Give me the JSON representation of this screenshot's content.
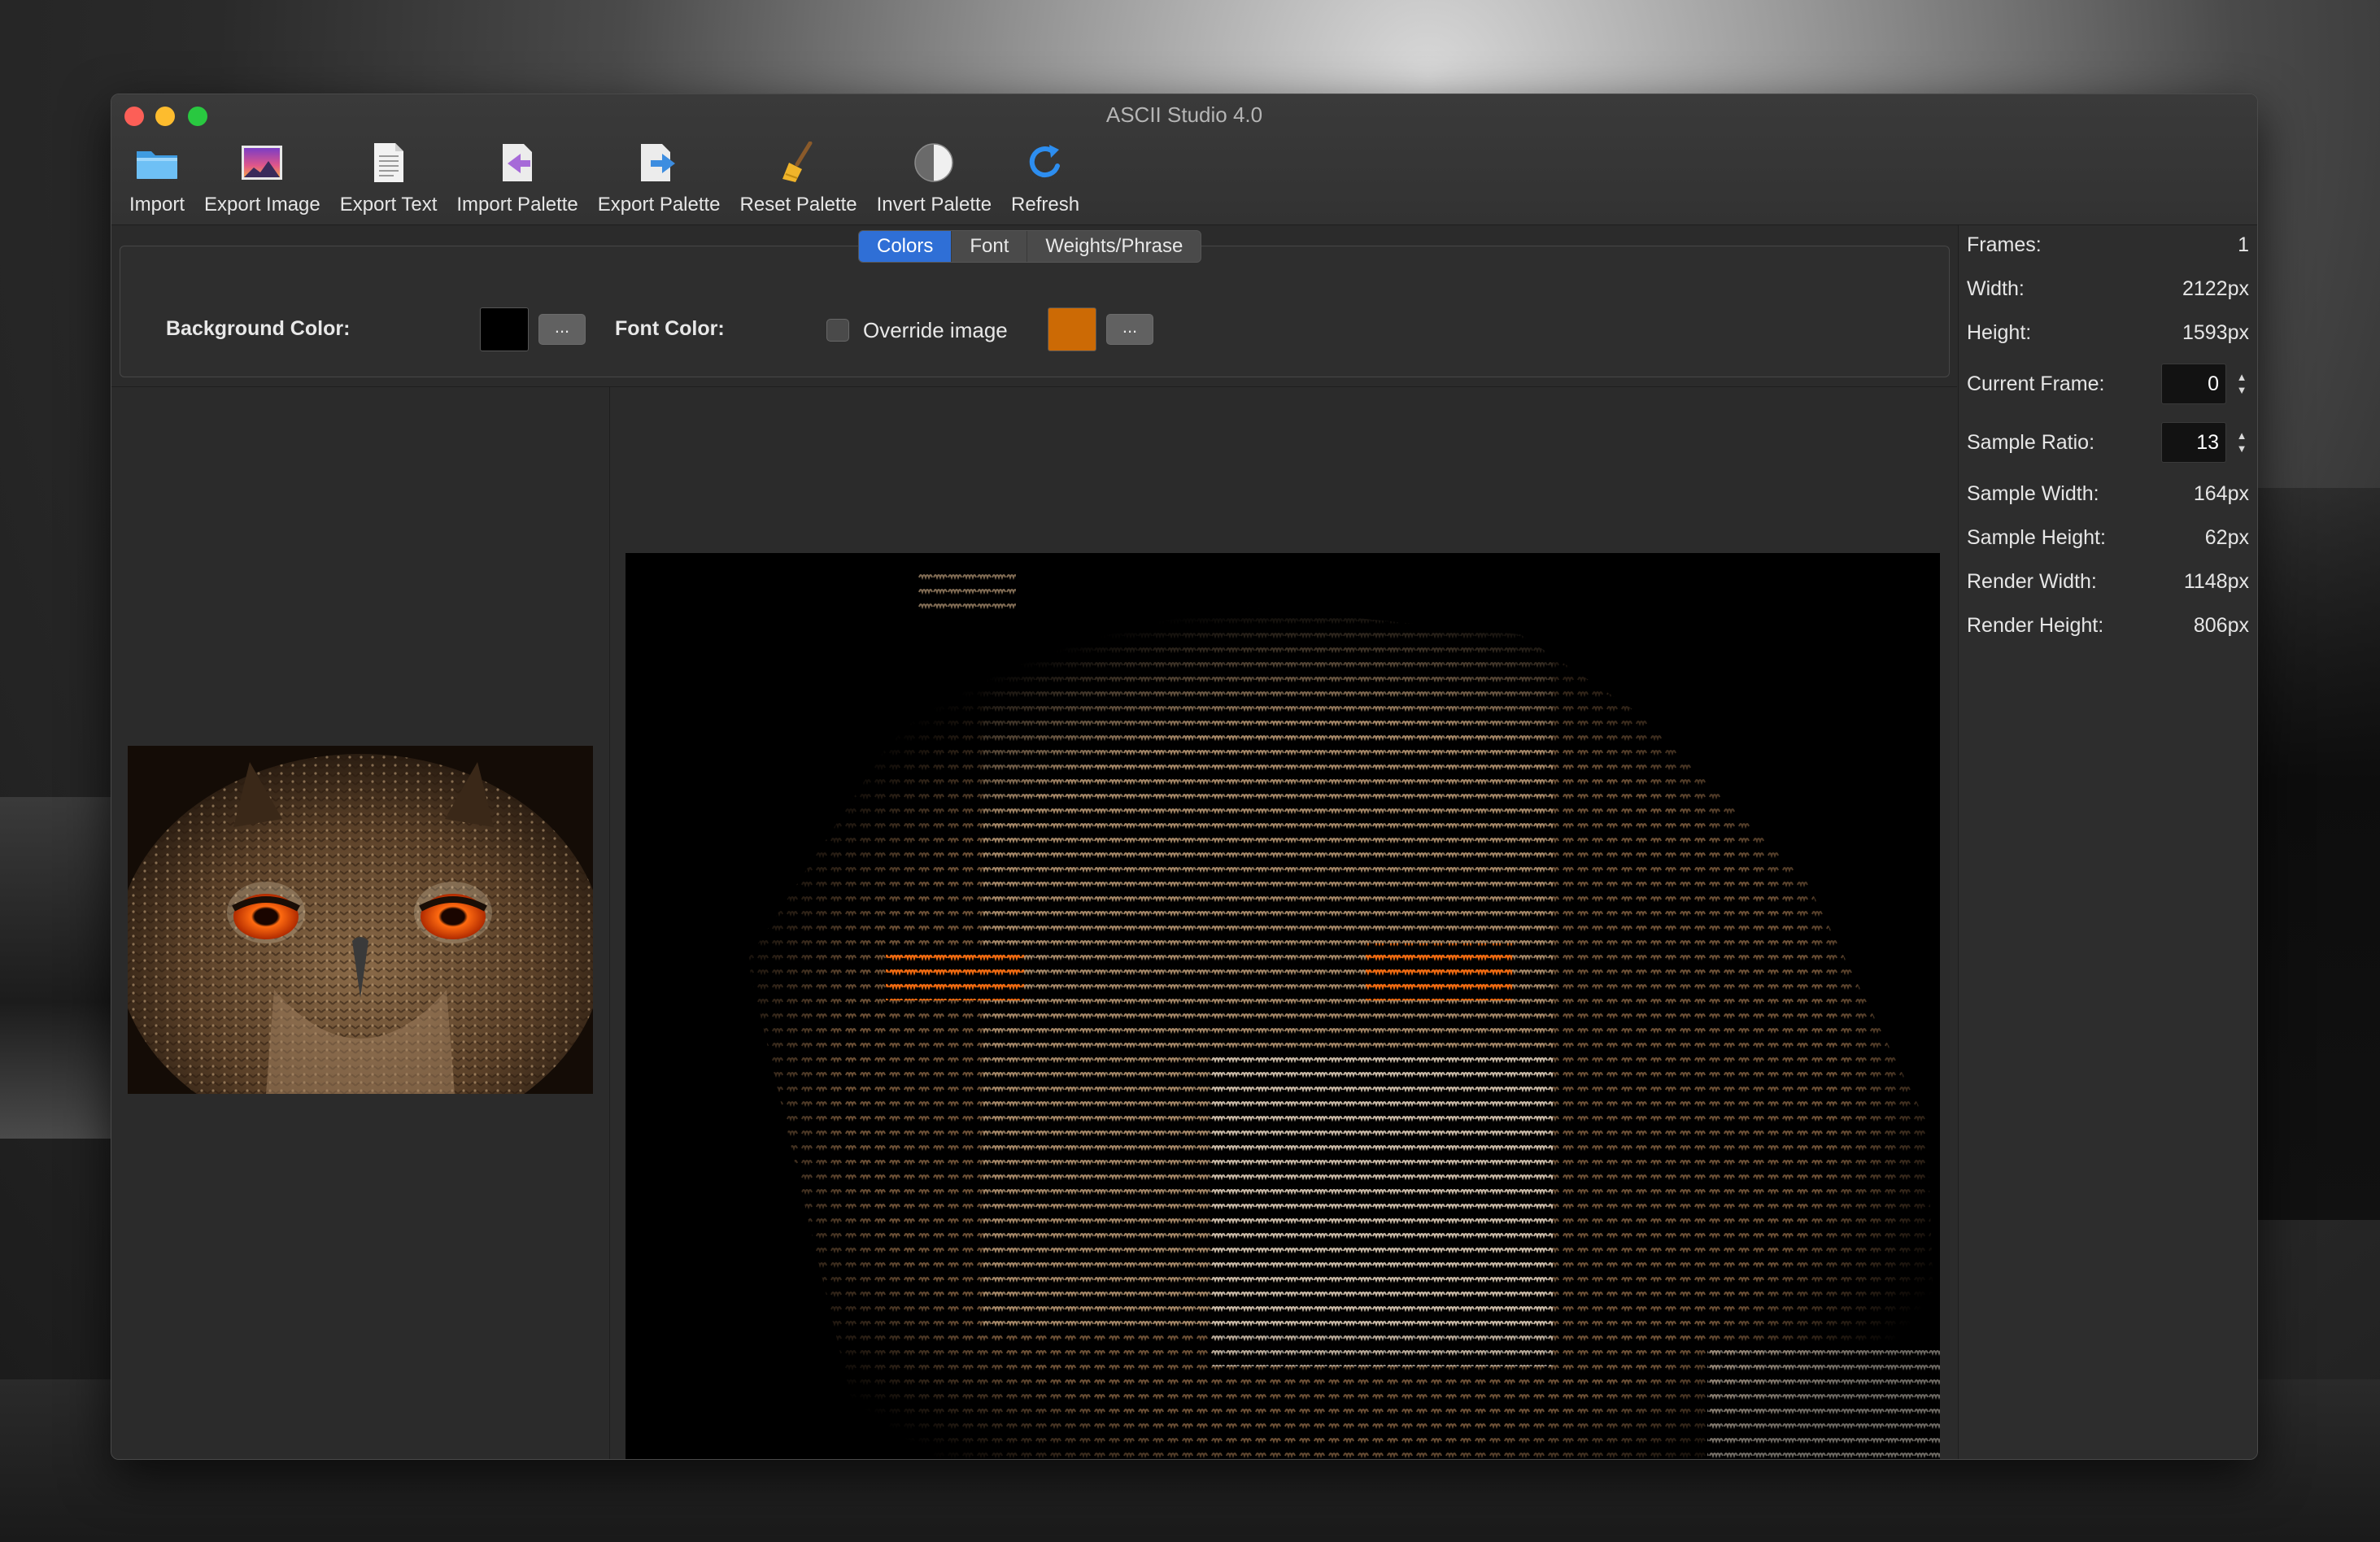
{
  "window": {
    "title": "ASCII Studio 4.0"
  },
  "toolbar": {
    "items": [
      {
        "label": "Import",
        "icon": "folder-icon"
      },
      {
        "label": "Export Image",
        "icon": "image-icon"
      },
      {
        "label": "Export Text",
        "icon": "document-icon"
      },
      {
        "label": "Import Palette",
        "icon": "import-palette-icon"
      },
      {
        "label": "Export Palette",
        "icon": "export-palette-icon"
      },
      {
        "label": "Reset Palette",
        "icon": "broom-icon"
      },
      {
        "label": "Invert Palette",
        "icon": "half-circle-icon"
      },
      {
        "label": "Refresh",
        "icon": "refresh-icon"
      }
    ]
  },
  "tabs": {
    "items": [
      "Colors",
      "Font",
      "Weights/Phrase"
    ],
    "selected": "Colors"
  },
  "colors_panel": {
    "background_label": "Background Color:",
    "background_color": "#000000",
    "font_label": "Font Color:",
    "override_label": "Override image",
    "override_checked": false,
    "font_color": "#cc6a05",
    "picker_label": "..."
  },
  "properties": {
    "frames_label": "Frames:",
    "frames_value": "1",
    "width_label": "Width:",
    "width_value": "2122px",
    "height_label": "Height:",
    "height_value": "1593px",
    "current_frame_label": "Current Frame:",
    "current_frame_value": "0",
    "sample_ratio_label": "Sample Ratio:",
    "sample_ratio_value": "13",
    "sample_width_label": "Sample Width:",
    "sample_width_value": "164px",
    "sample_height_label": "Sample Height:",
    "sample_height_value": "62px",
    "render_width_label": "Render Width:",
    "render_width_value": "1148px",
    "render_height_label": "Render Height:",
    "render_height_value": "806px"
  }
}
